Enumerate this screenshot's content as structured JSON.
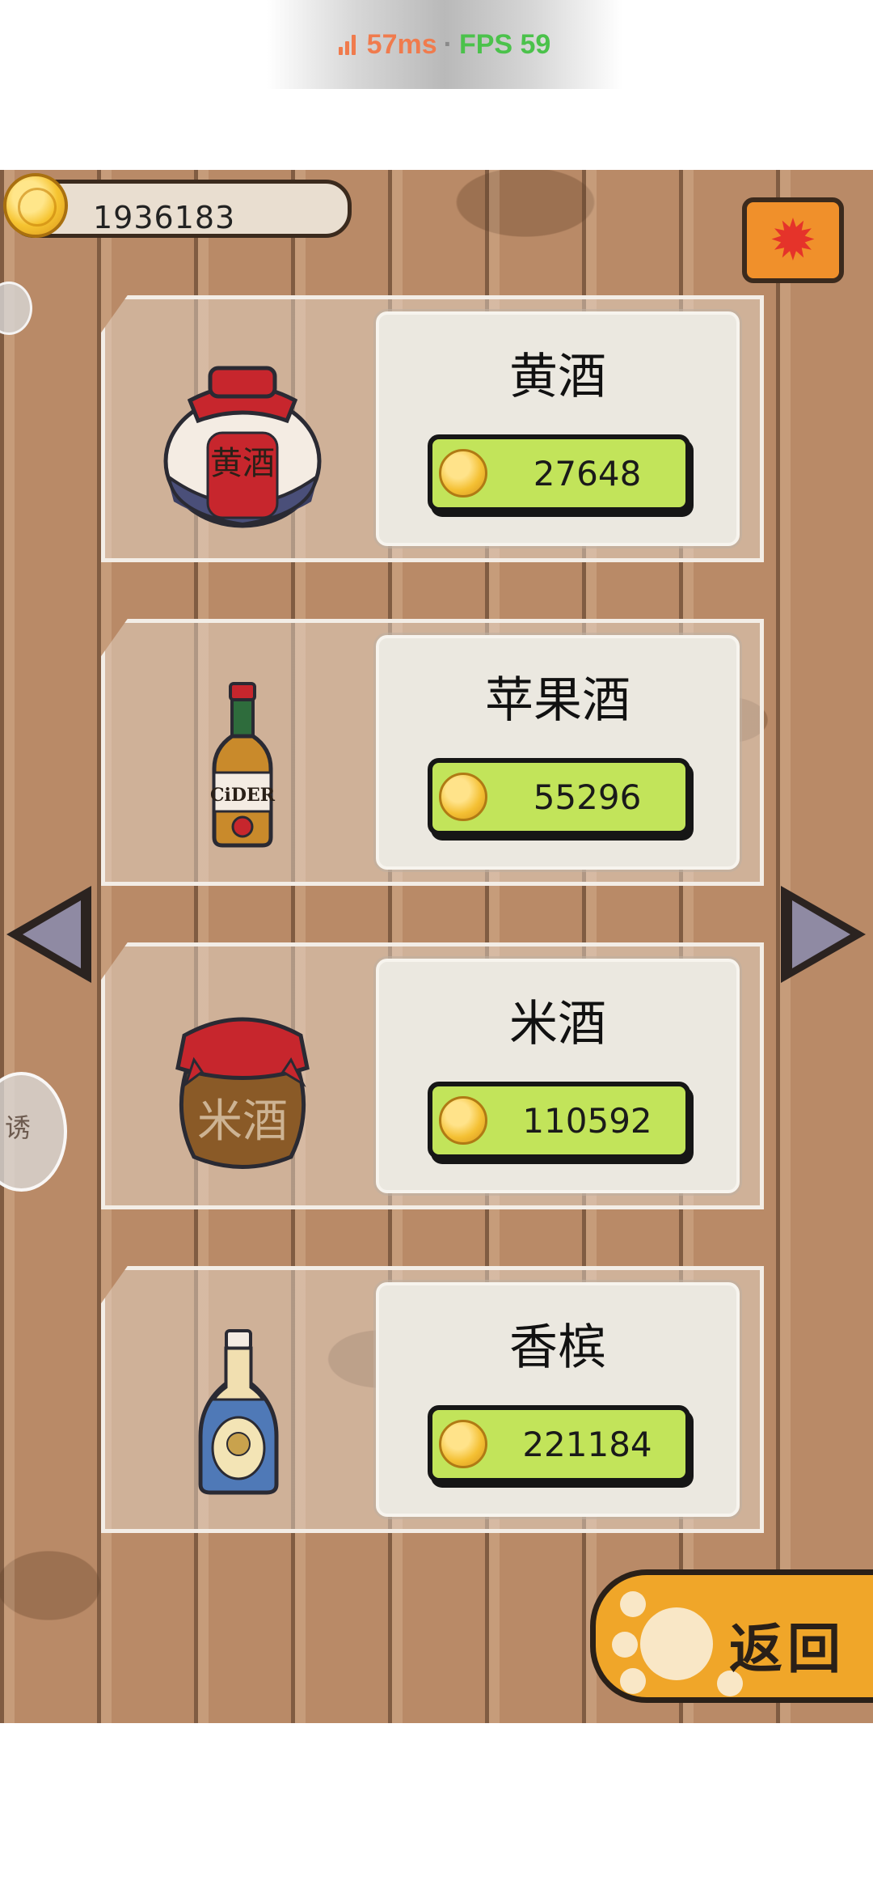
{
  "status": {
    "latency": "57ms",
    "separator": "·",
    "fps": "FPS 59"
  },
  "hud": {
    "coins": "1936183"
  },
  "side_bubble_text": "诱",
  "items": [
    {
      "name": "黄酒",
      "price": "27648",
      "label_text": "黄酒"
    },
    {
      "name": "苹果酒",
      "price": "55296",
      "label_text": "CiDER"
    },
    {
      "name": "米酒",
      "price": "110592",
      "label_text": "米酒"
    },
    {
      "name": "香槟",
      "price": "221184",
      "label_text": ""
    }
  ],
  "back_button": {
    "label": "返回"
  },
  "colors": {
    "wood": "#b98a67",
    "button_green": "#c2e45a",
    "settings_orange": "#f0902b",
    "paw_orange": "#f0a629",
    "latency_color": "#f07b4d",
    "fps_color": "#4bc24b"
  },
  "icons": [
    "signal-icon",
    "coin-icon",
    "gear-icon",
    "left-arrow-icon",
    "right-arrow-icon",
    "paw-icon"
  ]
}
